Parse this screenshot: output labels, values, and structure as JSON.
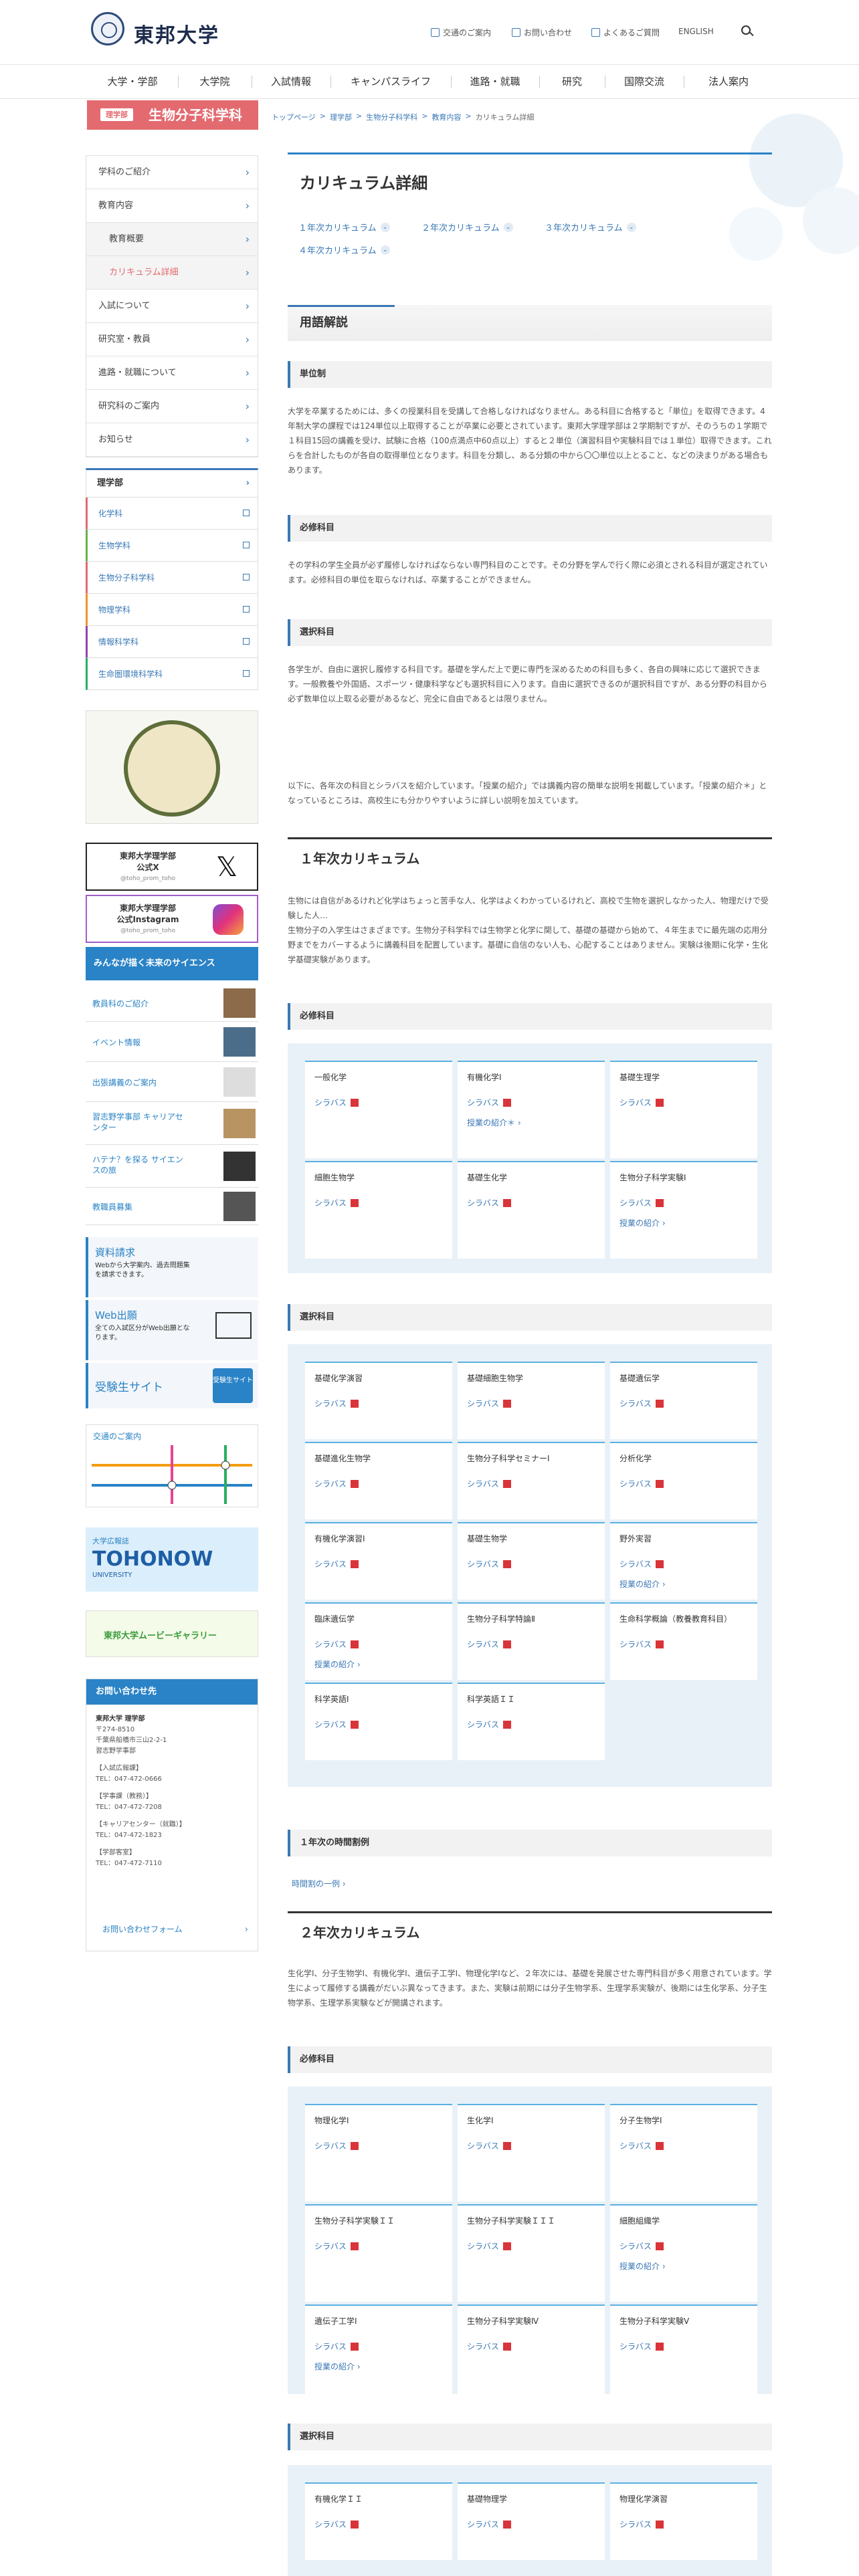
{
  "header": {
    "logo": "東邦大学",
    "utilities": [
      "交通のご案内",
      "お問い合わせ",
      "よくあるご質問",
      "ENGLISH"
    ]
  },
  "gnav": [
    "大学・学部",
    "大学院",
    "入試情報",
    "キャンパスライフ",
    "進路・就職",
    "研究",
    "国際交流",
    "法人案内"
  ],
  "section": {
    "badge": "理学部",
    "title": "生物分子科学科"
  },
  "breadcrumb": [
    "トップページ",
    "理学部",
    "生物分子科学科",
    "教育内容",
    "カリキュラム詳細"
  ],
  "side_menu": [
    {
      "label": "学科のご紹介"
    },
    {
      "label": "教育内容"
    },
    {
      "label": "教育概要",
      "sub": true
    },
    {
      "label": "カリキュラム詳細",
      "sub": true,
      "active": true
    },
    {
      "label": "入試について"
    },
    {
      "label": "研究室・教員"
    },
    {
      "label": "進路・就職について"
    },
    {
      "label": "研究科のご案内"
    },
    {
      "label": "お知らせ"
    }
  ],
  "dept": {
    "head": "理学部",
    "items": [
      {
        "label": "化学科",
        "color": "#e36a6f"
      },
      {
        "label": "生物学科",
        "color": "#6ab04c"
      },
      {
        "label": "生物分子科学科",
        "color": "#e36a6f"
      },
      {
        "label": "物理学科",
        "color": "#f0932b"
      },
      {
        "label": "情報科学科",
        "color": "#8e44ad"
      },
      {
        "label": "生命圏環境科学科",
        "color": "#27ae60"
      }
    ]
  },
  "banners": {
    "x": {
      "line1": "東邦大学理学部",
      "line2": "公式X",
      "handle": "@toho_prom_toho"
    },
    "insta": {
      "line1": "東邦大学理学部",
      "line2": "公式Instagram",
      "handle": "@toho_prom_toho"
    },
    "science": "みんなが描く未来のサイエンス",
    "links": [
      "教員科のご紹介",
      "イベント情報",
      "出張講義のご案内",
      "習志野学事部 キャリアセンター",
      "ハテナ？を探る サイエンスの旅",
      "教職員募集"
    ],
    "request": {
      "title": "資料請求",
      "desc": "Webから大学案内、過去問題集を請求できます。"
    },
    "web": {
      "title": "Web出願",
      "desc": "全ての入試区分がWeb出願となります。"
    },
    "juken": "受験生サイト",
    "juken_btn": "受験生サイト",
    "access": "交通のご案内",
    "magazine_label": "大学広報誌",
    "magazine": "TOHONOW",
    "magazine_sub": "UNIVERSITY",
    "movie": "東邦大学ムービーギャラリー"
  },
  "contact": {
    "title": "お問い合わせ先",
    "lines": [
      "東邦大学 理学部",
      "〒274-8510",
      "千葉県船橋市三山2-2-1",
      "習志野学事部",
      "【入試広報課】",
      "TEL：047-472-0666",
      "【学事課（教務）】",
      "TEL：047-472-7208",
      "【キャリアセンター（就職）】",
      "TEL：047-472-1823",
      "【学部客室】",
      "TEL：047-472-7110"
    ],
    "form": "お問い合わせフォーム"
  },
  "main": {
    "title": "カリキュラム詳細",
    "toc": [
      "１年次カリキュラム",
      "２年次カリキュラム",
      "３年次カリキュラム",
      "４年次カリキュラム"
    ],
    "glossary_title": "用語解説",
    "unit_title": "単位制",
    "unit_text": "大学を卒業するためには、多くの授業科目を受講して合格しなければなりません。ある科目に合格すると「単位」を取得できます。4年制大学の課程では124単位以上取得することが卒業に必要とされています。東邦大学理学部は２学期制ですが、そのうちの１学期で１科目15回の講義を受け、試験に合格（100点満点中60点以上）すると２単位（演習科目や実験科目では１単位）取得できます。これらを合計したものが各自の取得単位となります。科目を分類し、ある分類の中から〇〇単位以上とること、などの決まりがある場合もあります。",
    "required_title": "必修科目",
    "required_text": "その学科の学生全員が必ず履修しなければならない専門科目のことです。その分野を学んで行く際に必須とされる科目が選定されています。必修科目の単位を取らなければ、卒業することができません。",
    "elective_title": "選択科目",
    "elective_text": "各学生が、自由に選択し履修する科目です。基礎を学んだ上で更に専門を深めるための科目も多く、各自の興味に応じて選択できます。一般教養や外国語、スポーツ・健康科学なども選択科目に入ります。自由に選択できるのが選択科目ですが、ある分野の科目から必ず数単位以上取る必要があるなど、完全に自由であるとは限りません。",
    "intro_text": "以下に、各年次の科目とシラバスを紹介しています。「授業の紹介」では講義内容の簡単な説明を掲載しています。「授業の紹介＊」となっているところは、高校生にも分かりやすいように詳しい説明を加えています。",
    "year1": {
      "title": "１年次カリキュラム",
      "text": "生物には自信があるけれど化学はちょっと苦手な人、化学はよくわかっているけれど、高校で生物を選択しなかった人、物理だけで受験した人…\n生物分子の入学生はさまざまです。生物分子科学科では生物学と化学に関して、基礎の基礎から始めて、４年生までに最先端の応用分野までをカバーするように講義科目を配置しています。基礎に自信のない人も、心配することはありません。実験は後期に化学・生化学基礎実験があります。",
      "required_label": "必修科目",
      "required": [
        {
          "name": "一般化学",
          "link": ""
        },
        {
          "name": "有機化学Ⅰ",
          "link": "授業の紹介＊"
        },
        {
          "name": "基礎生理学",
          "link": ""
        },
        {
          "name": "細胞生物学",
          "link": ""
        },
        {
          "name": "基礎生化学",
          "link": ""
        },
        {
          "name": "生物分子科学実験Ⅰ",
          "link": "授業の紹介"
        }
      ],
      "elective_label": "選択科目",
      "elective": [
        {
          "name": "基礎化学演習",
          "link": ""
        },
        {
          "name": "基礎細胞生物学",
          "link": ""
        },
        {
          "name": "基礎遺伝学",
          "link": ""
        },
        {
          "name": "基礎進化生物学",
          "link": ""
        },
        {
          "name": "生物分子科学セミナーⅠ",
          "link": ""
        },
        {
          "name": "分析化学",
          "link": ""
        },
        {
          "name": "有機化学演習Ⅰ",
          "link": ""
        },
        {
          "name": "基礎生物学",
          "link": ""
        },
        {
          "name": "野外実習",
          "link": "授業の紹介"
        },
        {
          "name": "臨床遺伝学",
          "link": "授業の紹介"
        },
        {
          "name": "生物分子科学特論Ⅱ",
          "link": ""
        },
        {
          "name": "生命科学概論（教養教育科目）",
          "link": ""
        },
        {
          "name": "科学英語Ⅰ",
          "link": ""
        },
        {
          "name": "科学英語ＩＩ",
          "link": ""
        }
      ],
      "timetable_title": "１年次の時間割例",
      "timetable_link": "時間割の一例"
    },
    "syllabus": "シラバス",
    "year2": {
      "title": "２年次カリキュラム",
      "text": "生化学Ⅰ、分子生物学Ⅰ、有機化学Ⅰ、遺伝子工学Ⅰ、物理化学Ⅰなど、２年次には、基礎を発展させた専門科目が多く用意されています。学生によって履修する講義がだいぶ異なってきます。また、実験は前期には分子生物学系、生理学系実験が、後期には生化学系、分子生物学系、生理学系実験などが開講されます。",
      "required_label": "必修科目",
      "required": [
        {
          "name": "物理化学Ⅰ",
          "link": ""
        },
        {
          "name": "生化学Ⅰ",
          "link": ""
        },
        {
          "name": "分子生物学Ⅰ",
          "link": ""
        },
        {
          "name": "生物分子科学実験ＩＩ",
          "link": ""
        },
        {
          "name": "生物分子科学実験ＩＩＩ",
          "link": ""
        },
        {
          "name": "細胞組織学",
          "link": "授業の紹介"
        },
        {
          "name": "遺伝子工学Ⅰ",
          "link": "授業の紹介"
        },
        {
          "name": "生物分子科学実験Ⅳ",
          "link": ""
        },
        {
          "name": "生物分子科学実験Ⅴ",
          "link": ""
        }
      ],
      "elective_label": "選択科目",
      "elective": [
        {
          "name": "有機化学ＩＩ",
          "link": ""
        },
        {
          "name": "基礎物理学",
          "link": ""
        },
        {
          "name": "物理化学演習",
          "link": ""
        }
      ]
    }
  }
}
